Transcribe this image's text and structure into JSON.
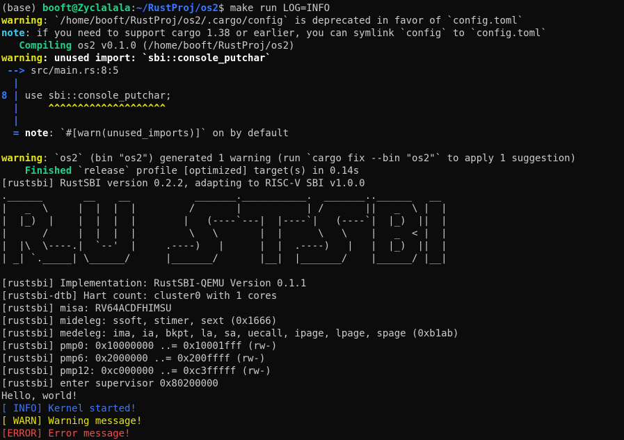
{
  "prompt": {
    "env": "(base) ",
    "user_host": "booft@Zyclalala",
    "colon": ":",
    "cwd": "~/RustProj/os2",
    "symbol": "$ ",
    "command": "make run LOG=INFO"
  },
  "warn1": {
    "label": "warning",
    "rest": ": `/home/booft/RustProj/os2/.cargo/config` is deprecated in favor of `config.toml`"
  },
  "note1": {
    "label": "note",
    "rest": ": if you need to support cargo 1.38 or earlier, you can symlink `config` to `config.toml`"
  },
  "compiling": {
    "label": "   Compiling",
    "rest": " os2 v0.1.0 (/home/booft/RustProj/os2)"
  },
  "warn2": {
    "label": "warning",
    "rest": ": unused import: `sbi::console_putchar`"
  },
  "arrow": {
    "marker": " --> ",
    "location": "src/main.rs:8:5"
  },
  "gutter_blank": "  |",
  "code_line": {
    "num": "8 |",
    "code": " use sbi::console_putchar;"
  },
  "carets": {
    "gutter": "  |",
    "marks": "     ^^^^^^^^^^^^^^^^^^^^"
  },
  "note2": {
    "prefix": "  = ",
    "label": "note",
    "rest": ": `#[warn(unused_imports)]` on by default"
  },
  "warn3": {
    "label": "warning",
    "rest": ": `os2` (bin \"os2\") generated 1 warning (run `cargo fix --bin \"os2\"` to apply 1 suggestion)"
  },
  "finished": {
    "label": "    Finished",
    "rest": " `release` profile [optimized] target(s) in 0.14s"
  },
  "rustsbi_version": "[rustsbi] RustSBI version 0.2.2, adapting to RISC-V SBI v1.0.0",
  "ascii_art": [
    ".______       __    __           _______.___________.  _______..______   __",
    "|   _  \\     |  |  |  |         /       |           | /       ||   _  \\ |  |",
    "|  |_)  |    |  |  |  |        |   (----`---|  |----`|   (----`|  |_)  ||  |",
    "|      /     |  |  |  |         \\   \\       |  |      \\   \\    |   _  < |  |",
    "|  |\\  \\----.|  `--'  |     .----)   |      |  |  .----)   |   |  |_)  ||  |",
    "| _| `._____| \\______/      |_______/       |__|  |_______/    |______/ |__|"
  ],
  "boot_lines": [
    "[rustsbi] Implementation: RustSBI-QEMU Version 0.1.1",
    "[rustsbi-dtb] Hart count: cluster0 with 1 cores",
    "[rustsbi] misa: RV64ACDFHIMSU",
    "[rustsbi] mideleg: ssoft, stimer, sext (0x1666)",
    "[rustsbi] medeleg: ima, ia, bkpt, la, sa, uecall, ipage, lpage, spage (0xb1ab)",
    "[rustsbi] pmp0: 0x10000000 ..= 0x10001fff (rw-)",
    "[rustsbi] pmp6: 0x2000000 ..= 0x200ffff (rw-)",
    "[rustsbi] pmp12: 0xc000000 ..= 0xc3fffff (rw-)",
    "[rustsbi] enter supervisor 0x80200000",
    "Hello, world!"
  ],
  "log": {
    "info": "[ INFO] Kernel started!",
    "warn": "[ WARN] Warning message!",
    "error": "[ERROR] Error message!"
  }
}
